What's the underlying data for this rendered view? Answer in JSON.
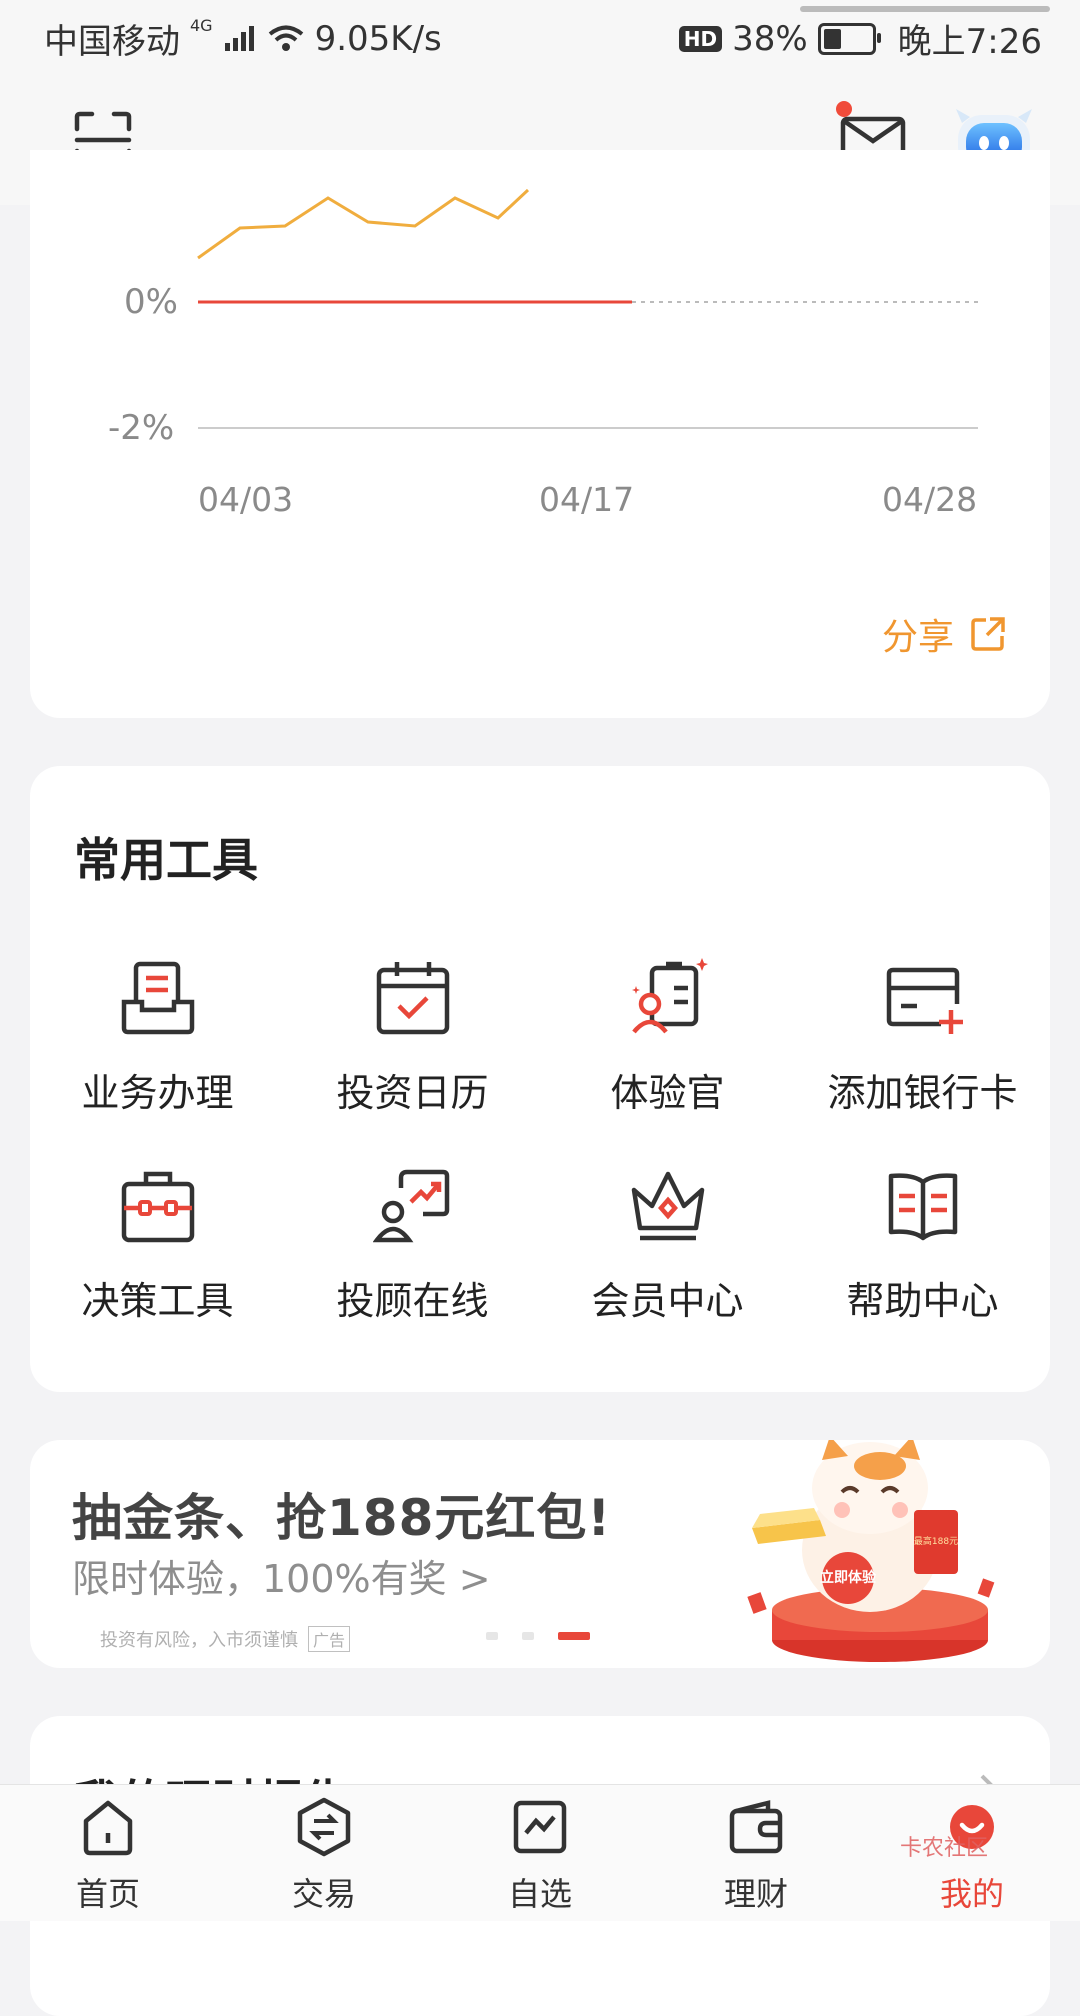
{
  "status_bar": {
    "carrier": "中国移动",
    "network": "4G",
    "speed": "9.05K/s",
    "hd": "HD",
    "battery": "38%",
    "battery_level": 0.38,
    "time": "晚上7:26"
  },
  "chart": {
    "y_labels": [
      "0%",
      "-2%"
    ],
    "x_labels": [
      "04/03",
      "04/17",
      "04/28"
    ],
    "share_label": "分享",
    "colors": {
      "line": "#f0ad3e",
      "baseline": "#e8473a",
      "axis": "#cccccc"
    }
  },
  "tools": {
    "title": "常用工具",
    "items": [
      {
        "label": "业务办理",
        "icon": "business-tray-icon"
      },
      {
        "label": "投资日历",
        "icon": "calendar-check-icon"
      },
      {
        "label": "体验官",
        "icon": "experience-officer-icon"
      },
      {
        "label": "添加银行卡",
        "icon": "add-card-icon"
      },
      {
        "label": "决策工具",
        "icon": "toolbox-icon"
      },
      {
        "label": "投顾在线",
        "icon": "advisor-chat-icon"
      },
      {
        "label": "会员中心",
        "icon": "crown-icon"
      },
      {
        "label": "帮助中心",
        "icon": "book-icon"
      }
    ]
  },
  "banner": {
    "title": "抽金条、抢188元红包!",
    "subtitle": "限时体验，100%有奖 >",
    "risk": "投资有风险，入市须谨慎",
    "ad_tag": "广告",
    "art_badge": "立即体验",
    "art_card": "最高188元",
    "active_slide": 3,
    "slides": 3
  },
  "report": {
    "title": "我的理财报告"
  },
  "tabbar": {
    "items": [
      {
        "label": "首页",
        "icon": "home-icon"
      },
      {
        "label": "交易",
        "icon": "trade-icon"
      },
      {
        "label": "自选",
        "icon": "watchlist-icon"
      },
      {
        "label": "理财",
        "icon": "wallet-icon"
      },
      {
        "label": "我的",
        "icon": "profile-icon"
      }
    ],
    "active": 4
  },
  "watermark": "卡农社区"
}
